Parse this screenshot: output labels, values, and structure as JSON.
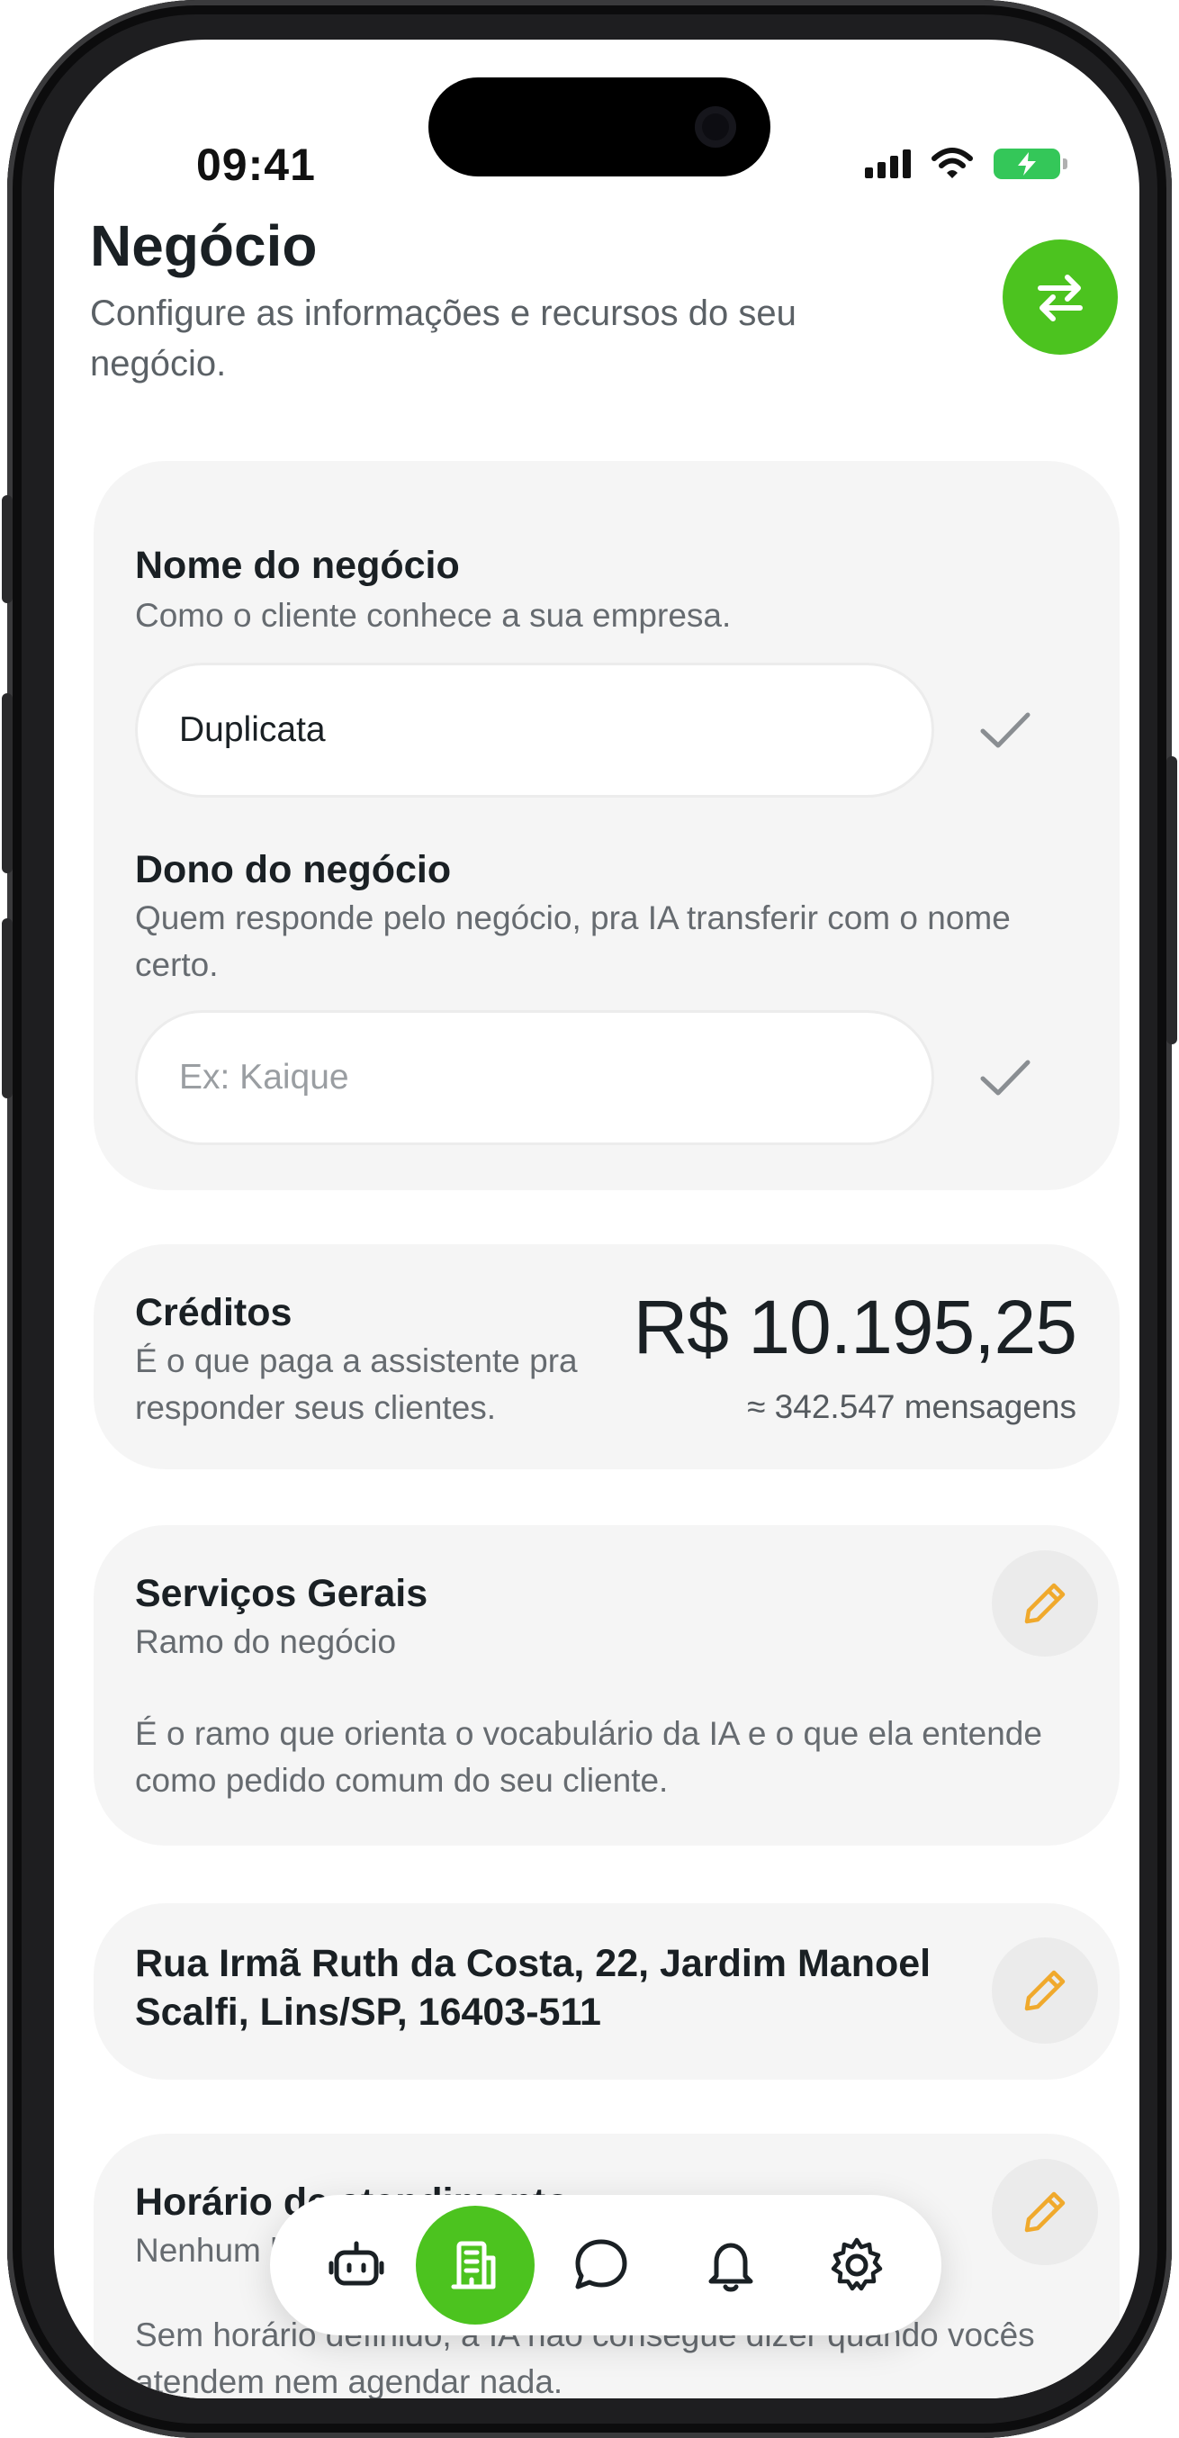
{
  "status_bar": {
    "time": "09:41"
  },
  "header": {
    "title": "Negócio",
    "subtitle": "Configure as informações e recursos do seu negócio."
  },
  "business_name": {
    "label": "Nome do negócio",
    "description": "Como o cliente conhece a sua empresa.",
    "value": "Duplicata"
  },
  "business_owner": {
    "label": "Dono do negócio",
    "description": "Quem responde pelo negócio, pra IA transferir com o nome certo.",
    "value": "",
    "placeholder": "Ex: Kaique"
  },
  "credits": {
    "label": "Créditos",
    "description": "É o que paga a assistente pra responder seus clientes.",
    "amount": "R$ 10.195,25",
    "messages": "≈ 342.547 mensagens"
  },
  "industry": {
    "title": "Serviços Gerais",
    "subtitle": "Ramo do negócio",
    "description": "É o ramo que orienta o vocabulário da IA e o que ela entende como pedido comum do seu cliente."
  },
  "address": {
    "text": "Rua Irmã Ruth da Costa, 22, Jardim Manoel Scalfi, Lins/SP, 16403-511"
  },
  "hours": {
    "title": "Horário de atendimento",
    "subtitle": "Nenhum horário definido",
    "description": "Sem horário definido, a IA não consegue dizer quando vocês atendem nem agendar nada."
  },
  "bottom_nav": {
    "items": [
      {
        "icon": "robot-icon",
        "active": false
      },
      {
        "icon": "building-icon",
        "active": true
      },
      {
        "icon": "chat-bubble-icon",
        "active": false
      },
      {
        "icon": "bell-icon",
        "active": false
      },
      {
        "icon": "gear-icon",
        "active": false
      }
    ]
  },
  "colors": {
    "accent": "#4cc31f",
    "edit_icon": "#f0a92c",
    "card_background": "#f5f5f5",
    "text_primary": "#1a2024",
    "text_secondary": "#666b70"
  }
}
